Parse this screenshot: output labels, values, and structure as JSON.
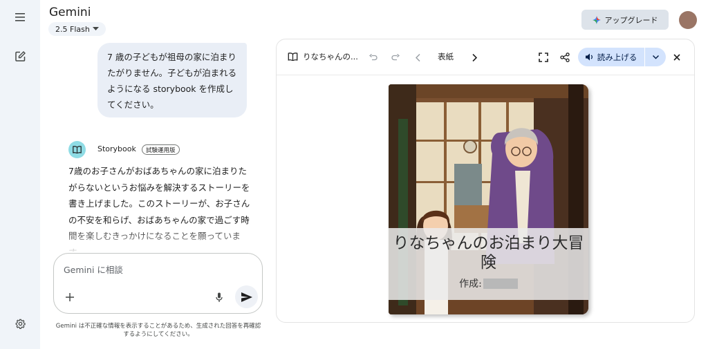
{
  "app": {
    "title": "Gemini",
    "model": "2.5 Flash",
    "upgrade_label": "アップグレード"
  },
  "chat": {
    "user_message": "7 歳の子どもが祖母の家に泊まりたがりません。子どもが泊まれるようになる storybook を作成してください。",
    "response_source": "Storybook",
    "response_badge": "試験運用版",
    "response_text": "7歳のお子さんがおばあちゃんの家に泊まりたがらないというお悩みを解決するストーリーを書き上げました。このストーリーが、お子さんの不安を和らげ、おばあちゃんの家で過ごす時間を楽しむきっかけになることを願っています。"
  },
  "input": {
    "placeholder": "Gemini に相談",
    "disclaimer": "Gemini は不正確な情報を表示することがあるため、生成された回答を再確認するようにしてください。"
  },
  "viewer": {
    "doc_title": "りなちゃんの...",
    "page_label": "表紙",
    "read_aloud_label": "読み上げる",
    "book": {
      "title": "りなちゃんのお泊まり大冒険",
      "author_label": "作成:"
    }
  },
  "colors": {
    "rail_bg": "#f0f4f9",
    "user_bubble": "#e9eef6",
    "read_button": "#d3e3fd",
    "storybook_icon": "#8fdce5"
  },
  "icons": [
    "menu-icon",
    "new-chat-icon",
    "settings-icon",
    "sparkle-icon",
    "book-icon",
    "undo-icon",
    "redo-icon",
    "chevron-left-icon",
    "chevron-right-icon",
    "fullscreen-icon",
    "share-icon",
    "speaker-icon",
    "chevron-down-icon",
    "close-icon",
    "plus-icon",
    "mic-icon",
    "send-icon"
  ]
}
